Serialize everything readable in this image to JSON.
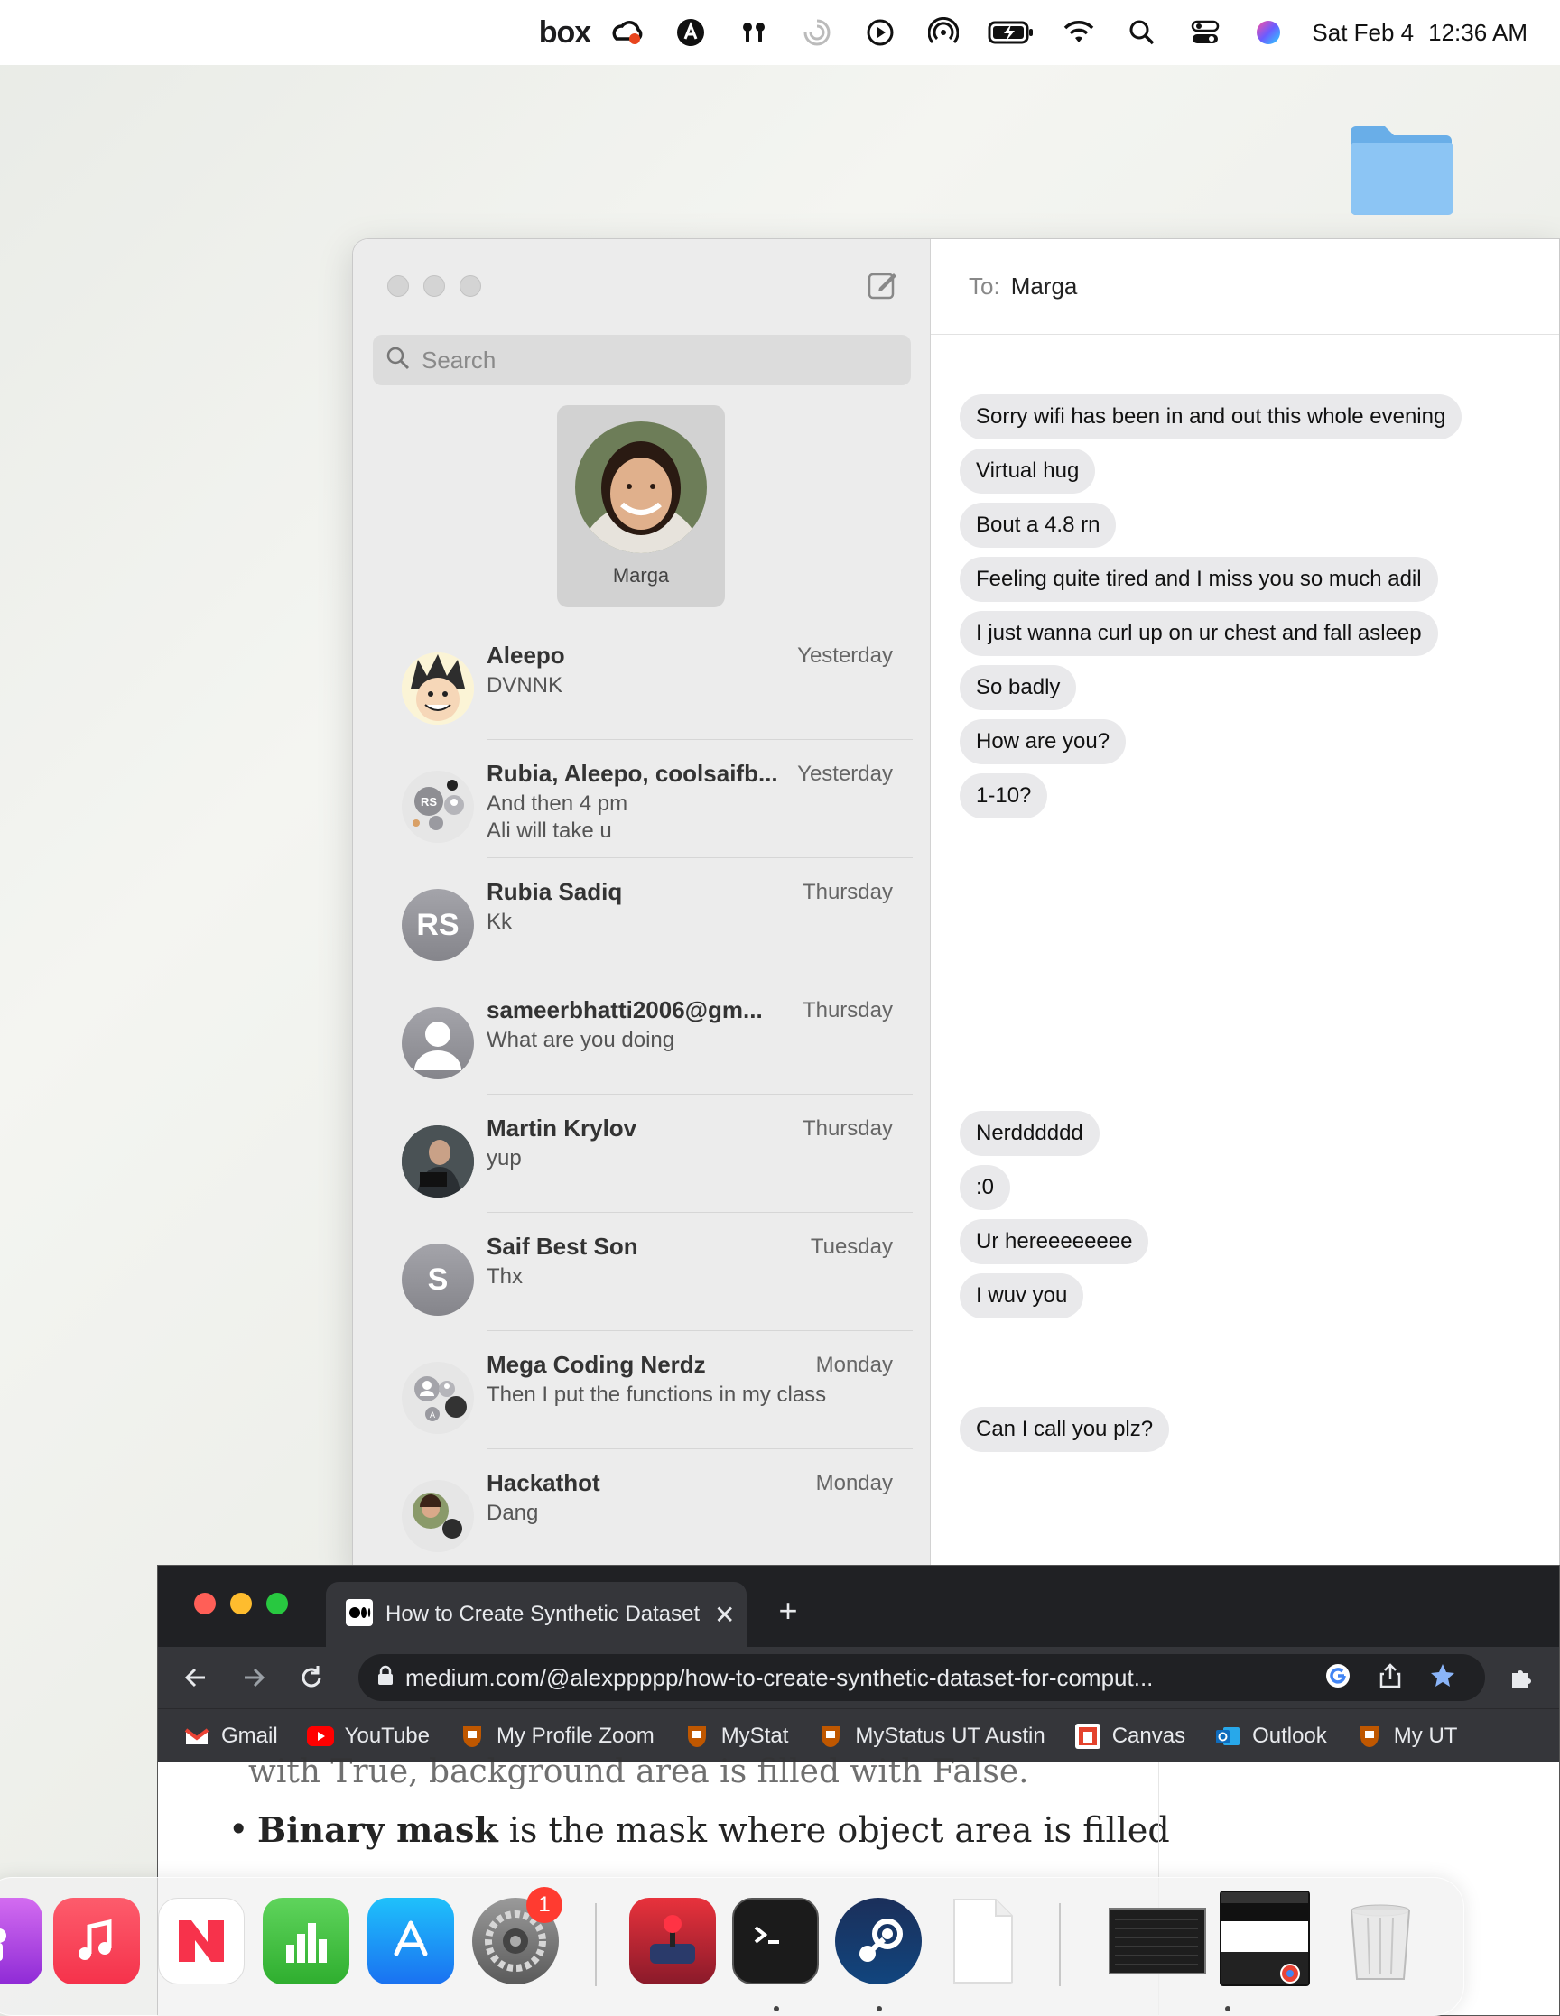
{
  "menubar": {
    "box_label": "box",
    "date": "Sat Feb 4",
    "time": "12:36 AM",
    "icons": [
      "box-icon",
      "creative-cloud-icon",
      "avast-icon",
      "airpods-icon",
      "loading-icon",
      "play-icon",
      "airdrop-icon",
      "battery-charging-icon",
      "wifi-icon",
      "search-icon",
      "control-center-icon",
      "siri-icon"
    ]
  },
  "messages": {
    "search_placeholder": "Search",
    "pinned": {
      "name": "Marga"
    },
    "conversations": [
      {
        "name": "Aleepo",
        "time": "Yesterday",
        "preview": "DVNNK",
        "avatar": "anime-avatar"
      },
      {
        "name": "Rubia, Aleepo, coolsaifb...",
        "time": "Yesterday",
        "preview": "And then 4 pm\nAli will take u",
        "avatar": "group-avatar",
        "initials": "RS"
      },
      {
        "name": "Rubia Sadiq",
        "time": "Thursday",
        "preview": "Kk",
        "avatar": "initials-avatar",
        "initials": "RS"
      },
      {
        "name": "sameerbhatti2006@gm...",
        "time": "Thursday",
        "preview": "What are you doing",
        "avatar": "person-silhouette-avatar"
      },
      {
        "name": "Martin Krylov",
        "time": "Thursday",
        "preview": "yup",
        "avatar": "photo-avatar"
      },
      {
        "name": "Saif Best Son",
        "time": "Tuesday",
        "preview": "Thx",
        "avatar": "initials-avatar",
        "initials": "S"
      },
      {
        "name": "Mega Coding Nerdz",
        "time": "Monday",
        "preview": "Then I put the functions in my class",
        "avatar": "group-avatar",
        "initials": "A"
      },
      {
        "name": "Hackathot",
        "time": "Monday",
        "preview": "Dang",
        "avatar": "group-photo-avatar"
      }
    ],
    "header": {
      "to_label": "To:",
      "to_name": "Marga"
    },
    "thread": [
      "Sorry wifi has been in and out this whole evening",
      "Virtual hug",
      "Bout a 4.8 rn",
      "Feeling quite tired and I miss you so much adil",
      "I just wanna curl up on ur chest and fall asleep",
      "So badly",
      "How are you?",
      "1-10?",
      "Nerdddddd",
      ":0",
      "Ur hereeeeeeee",
      "I wuv you",
      "Can I call you plz?"
    ]
  },
  "chrome": {
    "tab_title": "How to Create Synthetic Dataset for Computer Vision",
    "new_tab_label": "+",
    "url": "medium.com/@alexppppp/how-to-create-synthetic-dataset-for-comput...",
    "bookmarks": [
      {
        "label": "Gmail",
        "icon": "gmail-icon"
      },
      {
        "label": "YouTube",
        "icon": "youtube-icon"
      },
      {
        "label": "My Profile Zoom",
        "icon": "ut-shield-icon"
      },
      {
        "label": "MyStat",
        "icon": "ut-shield-icon"
      },
      {
        "label": "MyStatus UT Austin",
        "icon": "ut-shield-icon"
      },
      {
        "label": "Canvas",
        "icon": "canvas-icon"
      },
      {
        "label": "Outlook",
        "icon": "outlook-icon"
      },
      {
        "label": "My UT",
        "icon": "ut-shield-icon"
      }
    ],
    "article": {
      "cut_line": "with True, background area is filled with False.",
      "bullet_bold": "Binary mask",
      "bullet_rest": " is the mask where object area is filled"
    }
  },
  "dock": {
    "settings_badge": "1",
    "apps": [
      "podcasts-icon",
      "music-icon",
      "news-icon",
      "numbers-icon",
      "app-store-icon",
      "system-settings-icon",
      "joystick-app-icon",
      "terminal-icon",
      "steam-icon",
      "document-icon",
      "window-thumbnail-icon",
      "chrome-window-thumbnail-icon",
      "trash-icon"
    ]
  }
}
